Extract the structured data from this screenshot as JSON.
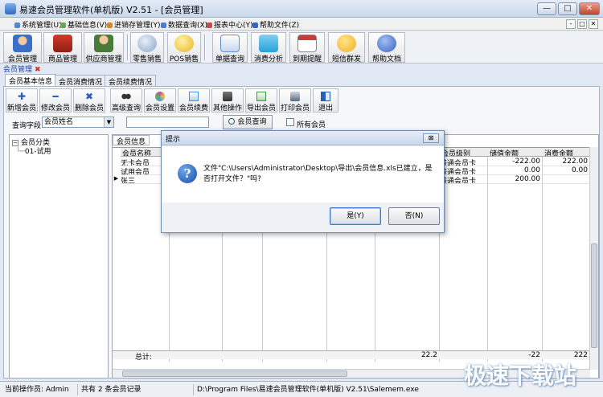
{
  "window": {
    "title": "易速会员管理软件(单机版) V2.51 - [会员管理]",
    "min": "—",
    "max": "□",
    "close": "✕"
  },
  "menu": {
    "items": [
      "系统管理(U)",
      "基础信息(V)",
      "进销存管理(Y)",
      "数据查询(X)",
      "报表中心(Y)",
      "帮助文件(Z)"
    ],
    "mdi": [
      "-",
      "□",
      "✕"
    ]
  },
  "toolbar": {
    "buttons": [
      {
        "label": "会员管理",
        "icon": "member-icon",
        "color": "#3b6fc7"
      },
      {
        "label": "商品管理",
        "icon": "goods-icon",
        "color": "#d23a2a"
      },
      {
        "label": "供应商管理",
        "icon": "supplier-icon",
        "color": "#4a7a3a"
      },
      {
        "label": "零售销售",
        "icon": "sale-icon",
        "color": "#8aa5cc"
      },
      {
        "label": "POS销售",
        "icon": "pos-icon",
        "color": "#e8b420"
      },
      {
        "label": "单据查询",
        "icon": "document-search-icon",
        "color": "#5f8fd0"
      },
      {
        "label": "消费分析",
        "icon": "tag-analysis-icon",
        "color": "#27a0d8"
      },
      {
        "label": "到期提醒",
        "icon": "calendar-icon",
        "color": "#c43d3d"
      },
      {
        "label": "短信群发",
        "icon": "sms-icon",
        "color": "#f0b020"
      },
      {
        "label": "帮助文档",
        "icon": "help-icon",
        "color": "#3a63c4"
      }
    ]
  },
  "doctab": {
    "label": "会员管理",
    "close": "✖"
  },
  "tabs": [
    "会员基本信息",
    "会员消费情况",
    "会员续费情况"
  ],
  "subtoolbar": [
    {
      "label": "新增会员",
      "icon": "plus-icon",
      "color": "#2a5fb8"
    },
    {
      "label": "修改会员",
      "icon": "minus-icon",
      "color": "#2a5fb8"
    },
    {
      "label": "删除会员",
      "icon": "x-icon",
      "color": "#2a5fb8"
    },
    {
      "label": "高级查询",
      "icon": "binoculars-icon",
      "color": "#333"
    },
    {
      "label": "会员设置",
      "icon": "settings-icon",
      "color": "#c94f9a"
    },
    {
      "label": "会员续费",
      "icon": "renew-icon",
      "color": "#4e8bd8"
    },
    {
      "label": "其他操作",
      "icon": "other-ops-icon",
      "color": "#555"
    },
    {
      "label": "导出会员",
      "icon": "export-icon",
      "color": "#3a9a4a"
    },
    {
      "label": "打印会员",
      "icon": "print-icon",
      "color": "#5a6a80"
    },
    {
      "label": "退出",
      "icon": "exit-icon",
      "color": "#2a5fb8"
    }
  ],
  "query": {
    "label": "查询字段",
    "field": "会员姓名",
    "value": "",
    "button": "会员查询",
    "all_label": "所有会员"
  },
  "tree": {
    "root": "会员分类",
    "child": "01-试用",
    "expander": "−"
  },
  "grid": {
    "tab": "会员信息",
    "columns": [
      "会员名称",
      "会员级别",
      "储值金额",
      "消费金额"
    ],
    "rows": [
      {
        "name": "无卡会员",
        "level": "普通会员卡",
        "stored": "-222.00",
        "spent": "222.00"
      },
      {
        "name": "试用会员",
        "level": "普通会员卡",
        "stored": "0.00",
        "spent": "0.00"
      },
      {
        "name": "张三",
        "level": "普通会员卡",
        "stored": "200.00",
        "spent": ""
      }
    ],
    "total_label": "总计:",
    "totals": {
      "a": "22.2",
      "stored": "-22",
      "spent": "222"
    }
  },
  "status": {
    "operator": "当前操作员: Admin",
    "count": "共有 2 条会员记录",
    "path": "D:\\Program Files\\易速会员管理软件(单机版) V2.51\\Salemem.exe"
  },
  "dialog": {
    "title": "提示",
    "close": "⊠",
    "message": "文件\"C:\\Users\\Administrator\\Desktop\\导出\\会员信息.xls已建立，是否打开文件？\"吗?",
    "yes": "是(Y)",
    "no": "否(N)"
  },
  "watermark": "极速下载站"
}
